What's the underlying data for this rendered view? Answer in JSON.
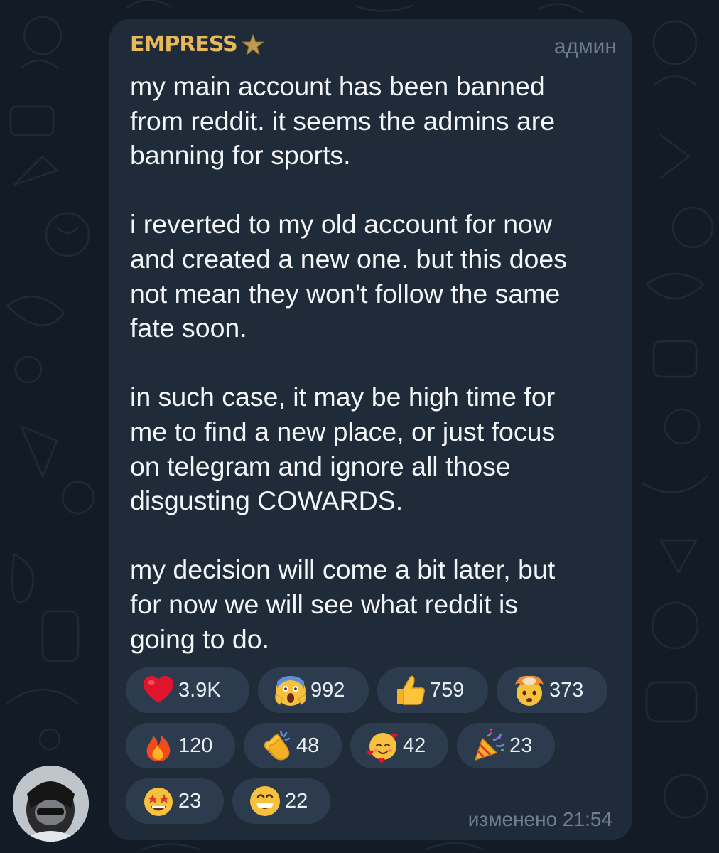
{
  "post": {
    "author": "EMPRESS",
    "author_badge_icon": "star-icon",
    "role": "админ",
    "paragraphs": [
      "my main account has been banned\nfrom reddit. it seems the admins are\nbanning for sports.",
      "i reverted to my old account for now\nand created a new one. but this does\nnot mean they won't follow the same\nfate soon.",
      "in such case, it may be high time for\nme to find a new place, or just focus\non telegram and ignore all those\ndisgusting COWARDS.",
      "my decision will come a bit later, but\nfor now we will see what reddit is\ngoing to do."
    ],
    "edited_label": "изменено 21:54"
  },
  "reactions": [
    {
      "icon": "red-heart-icon",
      "count": "3.9K"
    },
    {
      "icon": "screaming-face-icon",
      "count": "992"
    },
    {
      "icon": "thumbs-up-icon",
      "count": "759"
    },
    {
      "icon": "exploding-head-icon",
      "count": "373"
    },
    {
      "icon": "fire-icon",
      "count": "120"
    },
    {
      "icon": "clapping-hands-icon",
      "count": "48"
    },
    {
      "icon": "smiling-face-hearts-icon",
      "count": "42"
    },
    {
      "icon": "party-popper-icon",
      "count": "23"
    },
    {
      "icon": "star-struck-icon",
      "count": "23"
    },
    {
      "icon": "grinning-face-icon",
      "count": "22"
    }
  ],
  "colors": {
    "background": "#131c26",
    "bubble": "#1f2b38",
    "author": "#e8b85a",
    "reaction_chip": "#2c3c4e",
    "meta_text": "#6d7d8c"
  }
}
